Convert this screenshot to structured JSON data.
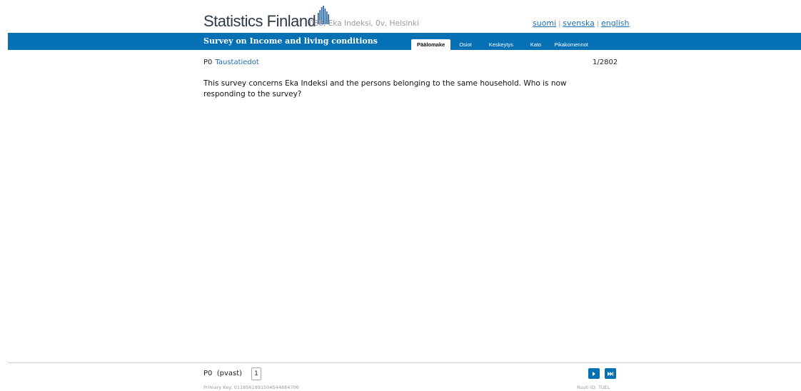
{
  "header": {
    "logo_text": "Statistics Finland",
    "case_info": "088, Eka Indeksi, 0v, Helsinki",
    "languages": [
      "suomi",
      "svenska",
      "english"
    ]
  },
  "band": {
    "title": "Survey on Income and living conditions",
    "tabs": [
      {
        "label": "Päälomake",
        "active": true
      },
      {
        "label": "Osiot",
        "active": false
      },
      {
        "label": "Keskeytys",
        "active": false
      },
      {
        "label": "Kato",
        "active": false
      },
      {
        "label": "Pikakomennot",
        "active": false
      }
    ]
  },
  "main": {
    "question_code": "P0",
    "section_link": "Taustatiedot",
    "counter": "1/2802",
    "question_text": "This survey concerns Eka Indeksi and the persons belonging to the same household. Who is now responding to the survey?"
  },
  "footer": {
    "variable_label": "P0  (pvast)",
    "answer_value": "1",
    "primary_key": "Primary Key: 0118561891504544884706",
    "ruuti_id": "Ruuti ID: TUEL",
    "nav_icons": [
      "next-icon",
      "last-icon"
    ]
  },
  "colors": {
    "brand_blue": "#0570b3",
    "link": "#1f6fb5"
  }
}
